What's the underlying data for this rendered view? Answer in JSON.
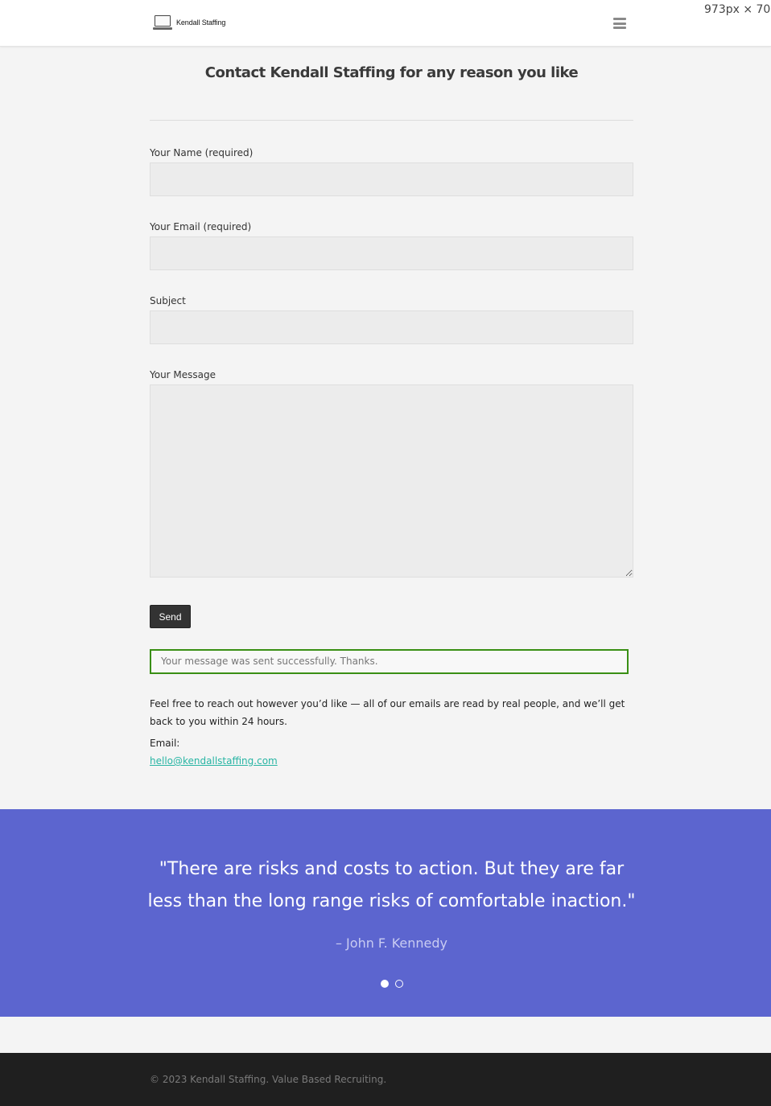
{
  "header": {
    "logo_text": "Kendall Staffing",
    "menu_icon": "hamburger-menu-icon",
    "viewport_size": "973px × 706p"
  },
  "page": {
    "title": "Contact Kendall Staffing for any reason you like"
  },
  "form": {
    "name_label": "Your Name (required)",
    "name_value": "",
    "email_label": "Your Email (required)",
    "email_value": "",
    "subject_label": "Subject",
    "subject_value": "",
    "message_label": "Your Message",
    "message_value": "",
    "send_label": "Send",
    "success_message": "Your message was sent successfully. Thanks."
  },
  "contact": {
    "intro": "Feel free to reach out however you’d like — all of our emails are read by real people, and we’ll get back to you within 24 hours.",
    "email_label": "Email:",
    "email_address": "hello@kendallstaffing.com"
  },
  "quote": {
    "text": "\"There are risks and costs to action. But they are far less than the long range risks of comfortable inaction.\"",
    "author": "– John F. Kennedy",
    "slides_total": 2,
    "active_slide": 1
  },
  "footer": {
    "copyright": "© 2023 Kendall Staffing. Value Based Recruiting."
  },
  "colors": {
    "quote_band": "#5c65cf",
    "success_border": "#398f14",
    "link": "#28b5a4",
    "footer_bg": "#1f1f1f"
  }
}
